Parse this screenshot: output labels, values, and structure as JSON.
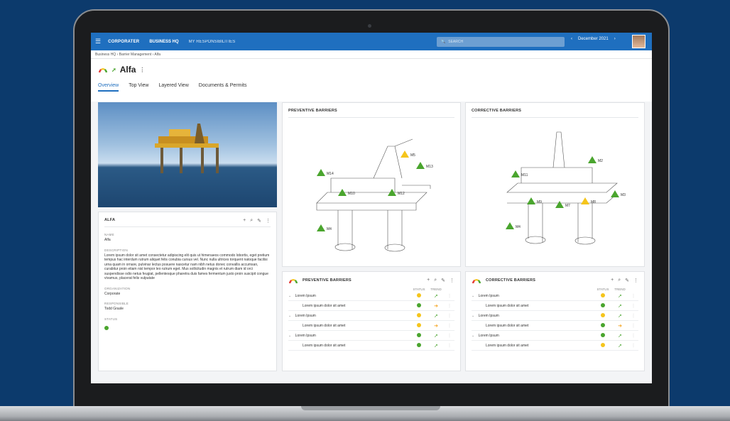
{
  "app": {
    "logo": "CORPORATER",
    "nav_main": "BUSINESS HQ",
    "nav_second": "MY RESPONSIBILITIES",
    "search_placeholder": "SEARCH",
    "date": "December 2021"
  },
  "breadcrumb": [
    "Business HQ",
    "Barrier Management",
    "Alfa"
  ],
  "page": {
    "title": "Alfa"
  },
  "tabs": [
    "Overview",
    "Top View",
    "Layered View",
    "Documents & Permits"
  ],
  "details": {
    "card_title": "ALFA",
    "name_label": "NAME",
    "name": "Alfa",
    "description_label": "DESCRIPTION",
    "description": "Lorem ipsum dolor sit amet consectetur adipiscing elit quis ut himenaeos commodo lobortis, eget pretium tempus hac interdum rutrum aliquet felis conubia cursus vel. Nunc nulla ultrices torquent natoque facilisi urna quam in ornare, pulvinar lectus posuere nascetur nam nibh netus donec convallis accumsan, curabitur proin etiam nisl tempor leo rutrum eget. Mus sollicitudin magnis et rutrum diam id orci suspendisse odio netus feugiat, pellentesque pharetra duis fames fermentum justo proin suscipit congue vivamus, placerat felis vulputate",
    "organization_label": "ORGANIZATION",
    "organization": "Corporate",
    "responsible_label": "RESPONSIBLE",
    "responsible": "Todd Grasle",
    "status_label": "STATUS",
    "status_color": "#4aa52e"
  },
  "preventive_view": {
    "title": "PREVENTIVE BARRIERS",
    "markers": [
      "M14",
      "M5",
      "M13",
      "M10",
      "M12",
      "M4"
    ]
  },
  "corrective_view": {
    "title": "CORRECTIVE BARRIERS",
    "markers": [
      "M2",
      "M11",
      "M9",
      "M7",
      "M8",
      "M3",
      "M4"
    ]
  },
  "preventive_table": {
    "title": "PREVENTIVE BARRIERS",
    "col_status": "STATUS",
    "col_trend": "TREND",
    "rows": [
      {
        "name": "Lorem Ipsum",
        "status": "#f5c51c",
        "trend": "up"
      },
      {
        "name": "Lorem ipsum dolor sit amet",
        "status": "#4aa52e",
        "trend": "flat"
      },
      {
        "name": "Lorem Ipsum",
        "status": "#f5c51c",
        "trend": "up"
      },
      {
        "name": "Lorem ipsum dolor sit amet",
        "status": "#f5c51c",
        "trend": "flat"
      },
      {
        "name": "Lorem Ipsum",
        "status": "#4aa52e",
        "trend": "up"
      },
      {
        "name": "Lorem ipsum dolor sit amet",
        "status": "#4aa52e",
        "trend": "up"
      }
    ]
  },
  "corrective_table": {
    "title": "CORRECTIVE BARRIERS",
    "col_status": "STATUS",
    "col_trend": "TREND",
    "rows": [
      {
        "name": "Lorem Ipsum",
        "status": "#f5c51c",
        "trend": "up"
      },
      {
        "name": "Lorem ipsum dolor sit amet",
        "status": "#4aa52e",
        "trend": "up"
      },
      {
        "name": "Lorem Ipsum",
        "status": "#f5c51c",
        "trend": "up"
      },
      {
        "name": "Lorem ipsum dolor sit amet",
        "status": "#4aa52e",
        "trend": "flat"
      },
      {
        "name": "Lorem Ipsum",
        "status": "#4aa52e",
        "trend": "up"
      },
      {
        "name": "Lorem ipsum dolor sit amet",
        "status": "#f5c51c",
        "trend": "up"
      }
    ]
  }
}
